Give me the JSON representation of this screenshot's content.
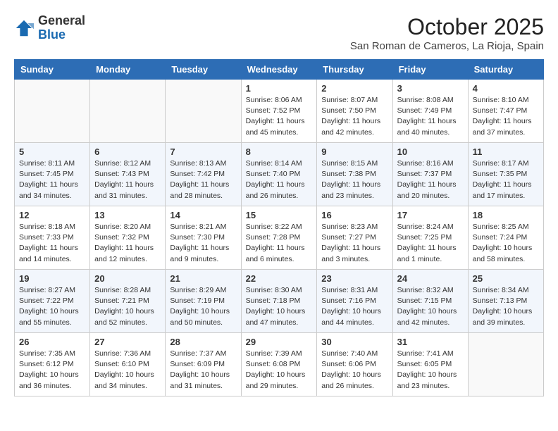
{
  "header": {
    "logo_general": "General",
    "logo_blue": "Blue",
    "month_title": "October 2025",
    "subtitle": "San Roman de Cameros, La Rioja, Spain"
  },
  "weekdays": [
    "Sunday",
    "Monday",
    "Tuesday",
    "Wednesday",
    "Thursday",
    "Friday",
    "Saturday"
  ],
  "weeks": [
    [
      {
        "day": "",
        "info": ""
      },
      {
        "day": "",
        "info": ""
      },
      {
        "day": "",
        "info": ""
      },
      {
        "day": "1",
        "info": "Sunrise: 8:06 AM\nSunset: 7:52 PM\nDaylight: 11 hours\nand 45 minutes."
      },
      {
        "day": "2",
        "info": "Sunrise: 8:07 AM\nSunset: 7:50 PM\nDaylight: 11 hours\nand 42 minutes."
      },
      {
        "day": "3",
        "info": "Sunrise: 8:08 AM\nSunset: 7:49 PM\nDaylight: 11 hours\nand 40 minutes."
      },
      {
        "day": "4",
        "info": "Sunrise: 8:10 AM\nSunset: 7:47 PM\nDaylight: 11 hours\nand 37 minutes."
      }
    ],
    [
      {
        "day": "5",
        "info": "Sunrise: 8:11 AM\nSunset: 7:45 PM\nDaylight: 11 hours\nand 34 minutes."
      },
      {
        "day": "6",
        "info": "Sunrise: 8:12 AM\nSunset: 7:43 PM\nDaylight: 11 hours\nand 31 minutes."
      },
      {
        "day": "7",
        "info": "Sunrise: 8:13 AM\nSunset: 7:42 PM\nDaylight: 11 hours\nand 28 minutes."
      },
      {
        "day": "8",
        "info": "Sunrise: 8:14 AM\nSunset: 7:40 PM\nDaylight: 11 hours\nand 26 minutes."
      },
      {
        "day": "9",
        "info": "Sunrise: 8:15 AM\nSunset: 7:38 PM\nDaylight: 11 hours\nand 23 minutes."
      },
      {
        "day": "10",
        "info": "Sunrise: 8:16 AM\nSunset: 7:37 PM\nDaylight: 11 hours\nand 20 minutes."
      },
      {
        "day": "11",
        "info": "Sunrise: 8:17 AM\nSunset: 7:35 PM\nDaylight: 11 hours\nand 17 minutes."
      }
    ],
    [
      {
        "day": "12",
        "info": "Sunrise: 8:18 AM\nSunset: 7:33 PM\nDaylight: 11 hours\nand 14 minutes."
      },
      {
        "day": "13",
        "info": "Sunrise: 8:20 AM\nSunset: 7:32 PM\nDaylight: 11 hours\nand 12 minutes."
      },
      {
        "day": "14",
        "info": "Sunrise: 8:21 AM\nSunset: 7:30 PM\nDaylight: 11 hours\nand 9 minutes."
      },
      {
        "day": "15",
        "info": "Sunrise: 8:22 AM\nSunset: 7:28 PM\nDaylight: 11 hours\nand 6 minutes."
      },
      {
        "day": "16",
        "info": "Sunrise: 8:23 AM\nSunset: 7:27 PM\nDaylight: 11 hours\nand 3 minutes."
      },
      {
        "day": "17",
        "info": "Sunrise: 8:24 AM\nSunset: 7:25 PM\nDaylight: 11 hours\nand 1 minute."
      },
      {
        "day": "18",
        "info": "Sunrise: 8:25 AM\nSunset: 7:24 PM\nDaylight: 10 hours\nand 58 minutes."
      }
    ],
    [
      {
        "day": "19",
        "info": "Sunrise: 8:27 AM\nSunset: 7:22 PM\nDaylight: 10 hours\nand 55 minutes."
      },
      {
        "day": "20",
        "info": "Sunrise: 8:28 AM\nSunset: 7:21 PM\nDaylight: 10 hours\nand 52 minutes."
      },
      {
        "day": "21",
        "info": "Sunrise: 8:29 AM\nSunset: 7:19 PM\nDaylight: 10 hours\nand 50 minutes."
      },
      {
        "day": "22",
        "info": "Sunrise: 8:30 AM\nSunset: 7:18 PM\nDaylight: 10 hours\nand 47 minutes."
      },
      {
        "day": "23",
        "info": "Sunrise: 8:31 AM\nSunset: 7:16 PM\nDaylight: 10 hours\nand 44 minutes."
      },
      {
        "day": "24",
        "info": "Sunrise: 8:32 AM\nSunset: 7:15 PM\nDaylight: 10 hours\nand 42 minutes."
      },
      {
        "day": "25",
        "info": "Sunrise: 8:34 AM\nSunset: 7:13 PM\nDaylight: 10 hours\nand 39 minutes."
      }
    ],
    [
      {
        "day": "26",
        "info": "Sunrise: 7:35 AM\nSunset: 6:12 PM\nDaylight: 10 hours\nand 36 minutes."
      },
      {
        "day": "27",
        "info": "Sunrise: 7:36 AM\nSunset: 6:10 PM\nDaylight: 10 hours\nand 34 minutes."
      },
      {
        "day": "28",
        "info": "Sunrise: 7:37 AM\nSunset: 6:09 PM\nDaylight: 10 hours\nand 31 minutes."
      },
      {
        "day": "29",
        "info": "Sunrise: 7:39 AM\nSunset: 6:08 PM\nDaylight: 10 hours\nand 29 minutes."
      },
      {
        "day": "30",
        "info": "Sunrise: 7:40 AM\nSunset: 6:06 PM\nDaylight: 10 hours\nand 26 minutes."
      },
      {
        "day": "31",
        "info": "Sunrise: 7:41 AM\nSunset: 6:05 PM\nDaylight: 10 hours\nand 23 minutes."
      },
      {
        "day": "",
        "info": ""
      }
    ]
  ]
}
